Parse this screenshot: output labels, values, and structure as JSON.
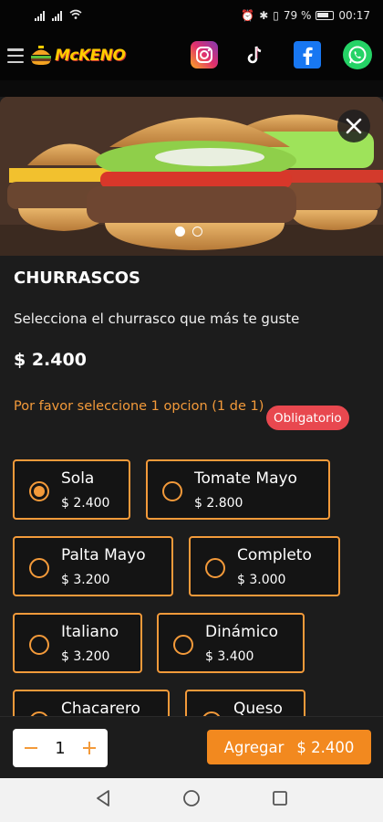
{
  "status": {
    "battery_text": "79 %",
    "time": "00:17"
  },
  "header": {
    "logo_text": "McKENO",
    "social": [
      "instagram-icon",
      "tiktok-icon",
      "facebook-icon",
      "whatsapp-icon"
    ]
  },
  "product": {
    "title": "CHURRASCOS",
    "description": "Selecciona el churrasco que más te guste",
    "price": "$ 2.400",
    "prompt": "Por favor seleccione 1 opcion (1 de 1)",
    "badge": "Obligatorio",
    "carousel": {
      "total": 2,
      "active": 1
    }
  },
  "options": [
    {
      "name": "Sola",
      "price": "$ 2.400",
      "selected": true
    },
    {
      "name": "Tomate Mayo",
      "price": "$ 2.800",
      "selected": false
    },
    {
      "name": "Palta Mayo",
      "price": "$ 3.200",
      "selected": false
    },
    {
      "name": "Completo",
      "price": "$ 3.000",
      "selected": false
    },
    {
      "name": "Italiano",
      "price": "$ 3.200",
      "selected": false
    },
    {
      "name": "Dinámico",
      "price": "$ 3.400",
      "selected": false
    },
    {
      "name": "Chacarero",
      "price": "",
      "selected": false
    },
    {
      "name": "Queso",
      "price": "",
      "selected": false
    }
  ],
  "cart": {
    "quantity": "1",
    "add_label": "Agregar",
    "add_price": "$ 2.400"
  },
  "colors": {
    "accent": "#f39a3a",
    "badge": "#e8484f",
    "background": "#1c1c1c"
  }
}
